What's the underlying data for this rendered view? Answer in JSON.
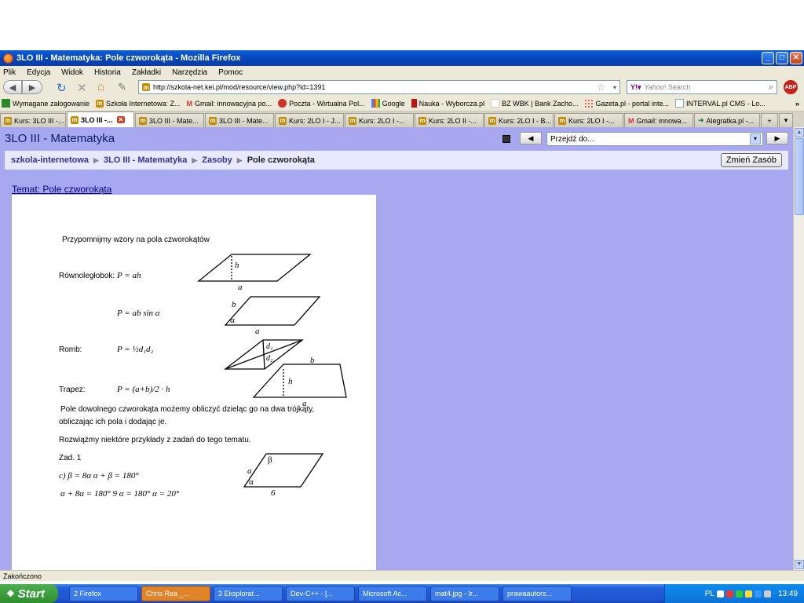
{
  "window": {
    "title": "3LO III - Matematyka: Pole czworokąta - Mozilla Firefox",
    "buttons": {
      "minimize": "_",
      "maximize": "□",
      "close": "✕"
    }
  },
  "menu": [
    "Plik",
    "Edycja",
    "Widok",
    "Historia",
    "Zakładki",
    "Narzędzia",
    "Pomoc"
  ],
  "navigation": {
    "url": "http://szkola-net.kei.pl/mod/resource/view.php?id=1391",
    "search_placeholder": "Yahoo! Search"
  },
  "bookmarks": [
    "Wymagane zalogowanie",
    "Szkoła Internetowa: Z...",
    "Gmail: innowacyjna po...",
    "Poczta - Wirtualna Pol...",
    "Google",
    "Nauka - Wyborcza.pl",
    "BZ WBK | Bank Zacho...",
    "Gazeta.pl - portal inte...",
    "INTERVAL.pl CMS - Lo..."
  ],
  "tabs": [
    "Kurs: 3LO III -...",
    "3LO III -...",
    "3LO III - Mate...",
    "3LO III - Mate...",
    "Kurs: 2LO I - J...",
    "Kurs: 2LO I -...",
    "Kurs: 2LO II -...",
    "Kurs: 2LO I - B...",
    "Kurs: 2LO I -...",
    "Gmail: innowa...",
    "Alegratka.pl -..."
  ],
  "page": {
    "title": "3LO III - Matematyka",
    "jump_placeholder": "Przejdź do...",
    "breadcrumb": [
      "szkola-internetowa",
      "3LO III - Matematyka",
      "Zasoby",
      "Pole czworokąta"
    ],
    "change_button": "Zmień Zasób",
    "topic": "Temat: Pole czworokąta"
  },
  "scan": {
    "heading": "Przypomnijmy wzory na pola czworokątów",
    "parallelogram_label": "Równoległobok:",
    "parallelogram_formula1": "P = ah",
    "parallelogram_formula2": "P = ab sin α",
    "rhombus_label": "Romb:",
    "rhombus_formula": "P = ½d₁d₂",
    "trapezoid_label": "Trapez:",
    "trapezoid_formula": "P = (a+b)/2 · h",
    "para1_line1": "Pole dowolnego czworokąta możemy obliczyć dzieląc go na dwa trójkąty,",
    "para1_line2": "obliczając ich pola i dodając je.",
    "para2": "Rozwiążmy niektóre przykłady z zadań do tego tematu.",
    "task": "Zad. 1",
    "task_c": "c)   β = 8α        α + β = 180°",
    "task_c2": "α + 8α = 180°    9 α = 180°    α = 20°",
    "fig_labels": {
      "h": "h",
      "a": "a",
      "alpha": "α",
      "b": "b",
      "d1": "d₁",
      "d2": "d₂",
      "beta": "β",
      "six": "6"
    }
  },
  "status": "Zakończono",
  "taskbar": {
    "start": "Start",
    "items": [
      "2 Firefox",
      "Chris Rea _...",
      "3 Eksplorat...",
      "Dev-C++ - [...",
      "Microsoft Ac...",
      "mat4.jpg - Ir...",
      "prawaautors..."
    ],
    "lang": "PL",
    "clock": "13:49"
  }
}
